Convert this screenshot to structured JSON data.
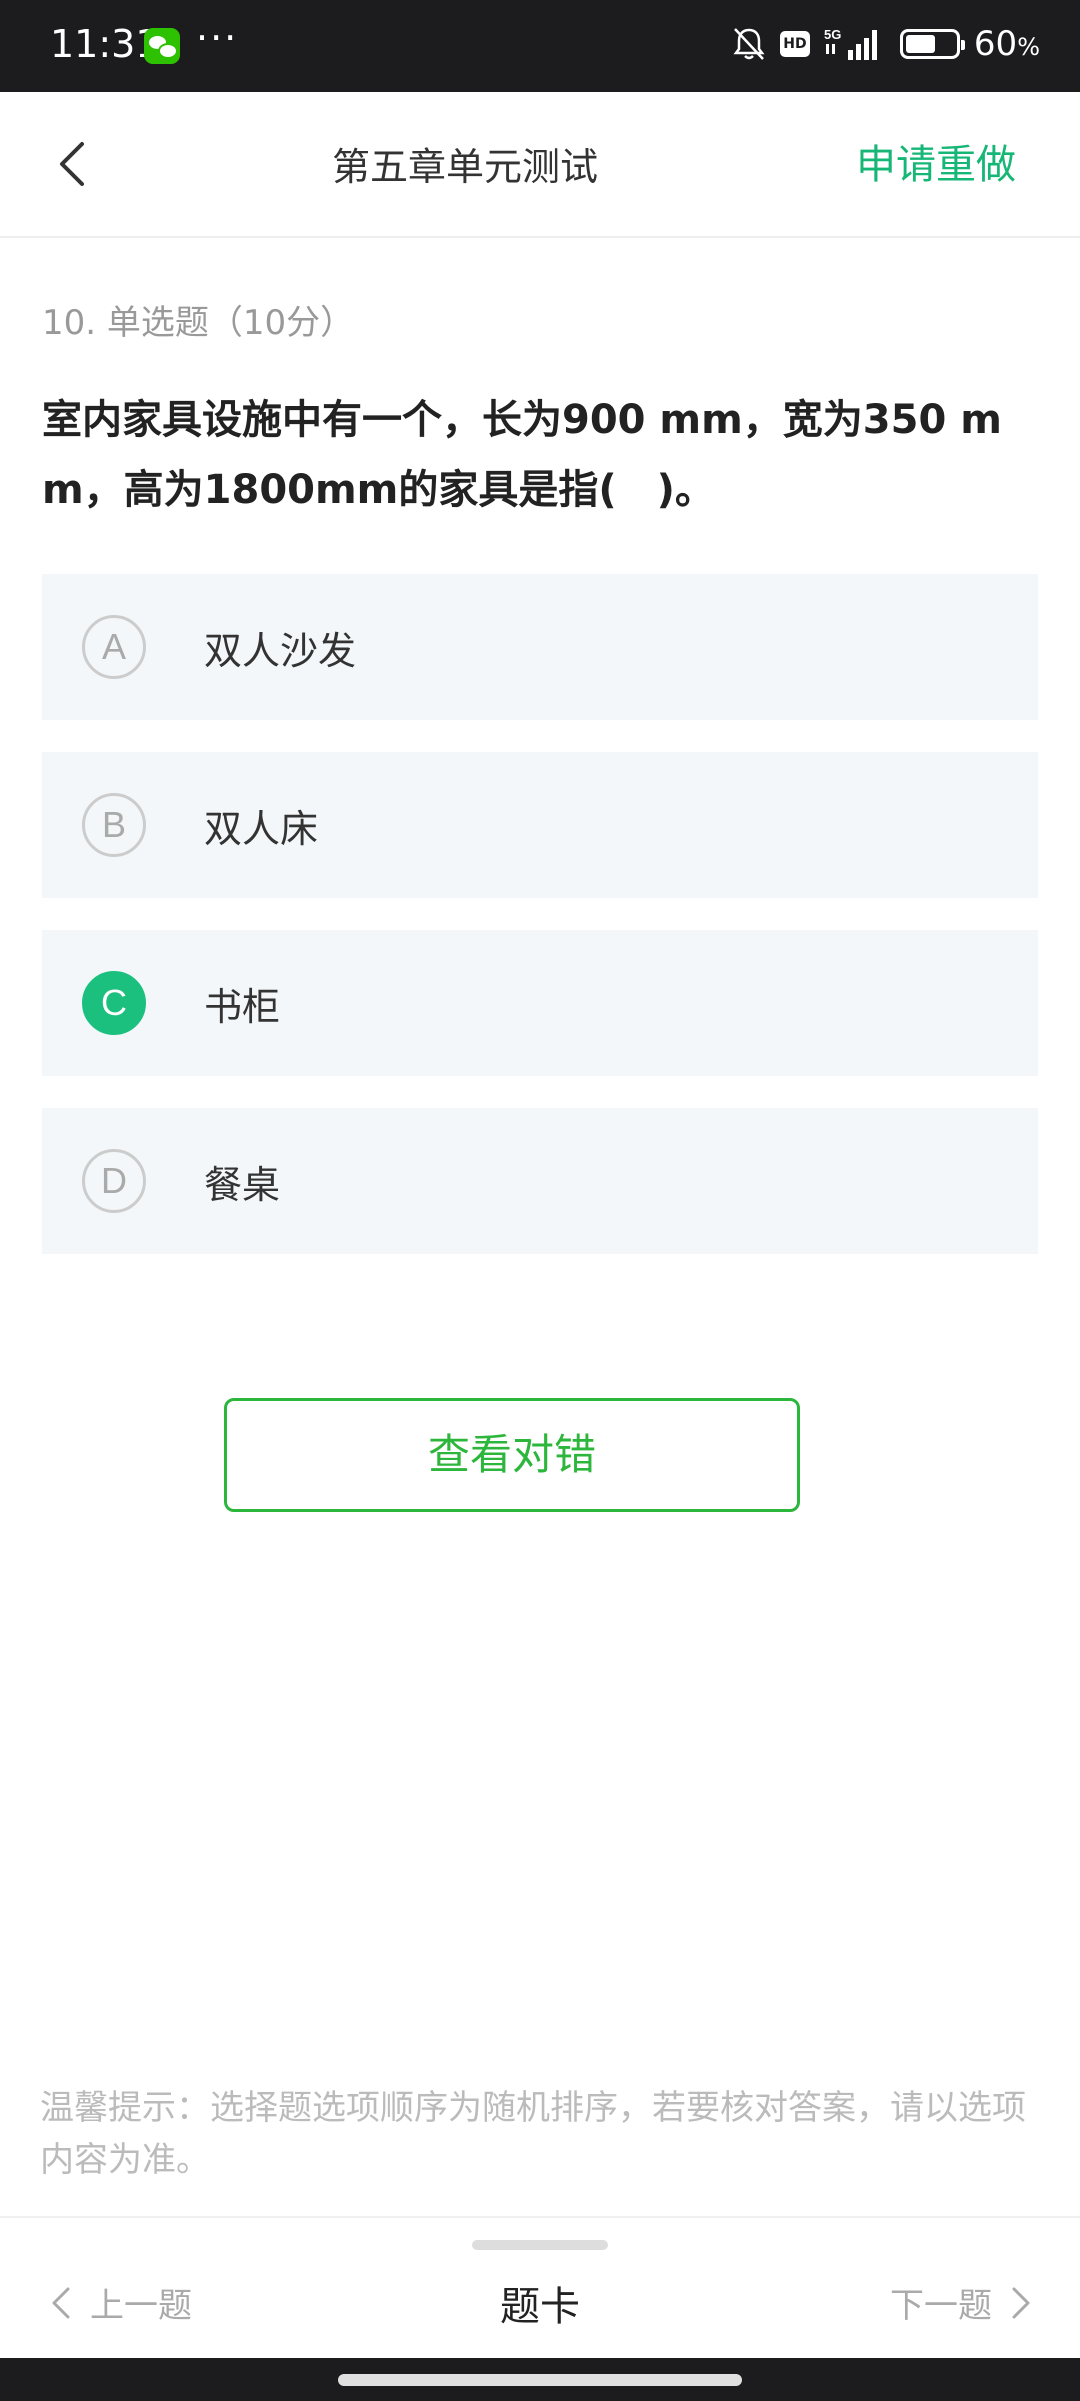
{
  "status_bar": {
    "time": "11:31",
    "dots": "···",
    "hd_label": "HD",
    "battery_percent_value": 60,
    "battery_text": "60",
    "battery_unit": "%"
  },
  "header": {
    "title": "第五章单元测试",
    "redo_label": "申请重做"
  },
  "question": {
    "meta": "10. 单选题（10分）",
    "text_line1": "室内家具设施中有一个，长为900 mm，宽为350 m",
    "text_line2": "m，高为1800mm的家具是指(　)。"
  },
  "options": [
    {
      "letter": "A",
      "text": "双人沙发",
      "selected": false
    },
    {
      "letter": "B",
      "text": "双人床",
      "selected": false
    },
    {
      "letter": "C",
      "text": "书柜",
      "selected": true
    },
    {
      "letter": "D",
      "text": "餐桌",
      "selected": false
    }
  ],
  "check_button_label": "查看对错",
  "tip": "温馨提示：选择题选项顺序为随机排序，若要核对答案，请以选项内容为准。",
  "bottom_nav": {
    "prev_label": "上一题",
    "card_label": "题卡",
    "next_label": "下一题"
  },
  "colors": {
    "accent": "#16b776",
    "selected": "#1bc07f",
    "check_button": "#2db63c"
  }
}
